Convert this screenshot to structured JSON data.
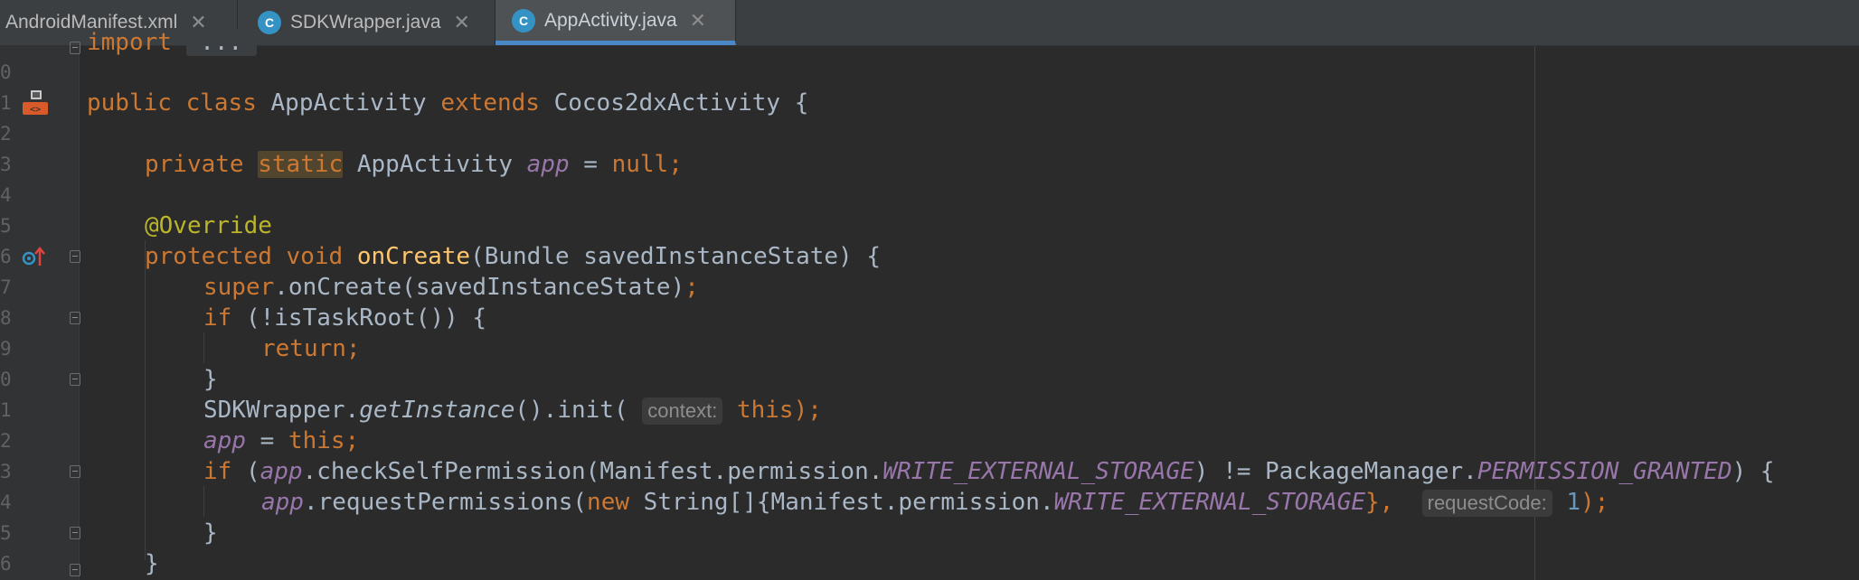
{
  "tabs": [
    {
      "label": "AndroidManifest.xml",
      "icon": "xml-file-icon"
    },
    {
      "label": "SDKWrapper.java",
      "icon": "java-class-icon"
    },
    {
      "label": "AppActivity.java",
      "icon": "java-class-icon",
      "active": true
    }
  ],
  "tab_icon_letter": "C",
  "close_glyph": "✕",
  "line_numbers": [
    "0",
    "1",
    "2",
    "3",
    "4",
    "5",
    "6",
    "7",
    "8",
    "9",
    "0",
    "1",
    "2",
    "3",
    "4",
    "5",
    "6"
  ],
  "code": {
    "l0_import": "import",
    "l0_fold": " ... ",
    "l2_public": "public",
    "l2_class": "class",
    "l2_name": "AppActivity",
    "l2_extends": "extends",
    "l2_super": "Cocos2dxActivity {",
    "l4_private": "private",
    "l4_static": "static",
    "l4_type": "AppActivity",
    "l4_field": "app",
    "l4_eq": " = ",
    "l4_null": "null;",
    "l6_ann": "@Override",
    "l7_protected": "protected",
    "l7_void": "void",
    "l7_method": "onCreate",
    "l7_params": "(Bundle savedInstanceState) {",
    "l8_super": "super",
    "l8_call": ".onCreate(savedInstanceState)",
    "l8_semi": ";",
    "l9_if": "if",
    "l9_cond": " (!isTaskRoot()) {",
    "l10_return": "return;",
    "l11_brace": "}",
    "l12_class": "SDKWrapper.",
    "l12_static": "getInstance",
    "l12_init": "().init( ",
    "l12_hint": "context:",
    "l12_this": "this",
    "l12_end": ");",
    "l13_app": "app",
    "l13_eq": " = ",
    "l13_this": "this;",
    "l14_if": "if",
    "l14_open": " (",
    "l14_app": "app",
    "l14_call": ".checkSelfPermission(Manifest.permission.",
    "l14_const": "WRITE_EXTERNAL_STORAGE",
    "l14_ne": ") != PackageManager.",
    "l14_const2": "PERMISSION_GRANTED",
    "l14_end": ") {",
    "l15_app": "app",
    "l15_call": ".requestPermissions(",
    "l15_new": "new",
    "l15_arr": " String[]{Manifest.permission.",
    "l15_const": "WRITE_EXTERNAL_STORAGE",
    "l15_close": "},",
    "l15_hint": "requestCode:",
    "l15_num": "1",
    "l15_end": ");",
    "l16_brace": "}",
    "l17_brace": "}"
  },
  "gutter_icons": [
    "class-implementation-icon",
    "override-method-icon"
  ],
  "colors": {
    "keyword": "#cc7832",
    "annotation": "#bbb529",
    "method": "#ffc66d",
    "field": "#9876aa",
    "number": "#6897bb",
    "text": "#a9b7c6",
    "background": "#2b2b2b",
    "accent": "#4a88c7"
  }
}
